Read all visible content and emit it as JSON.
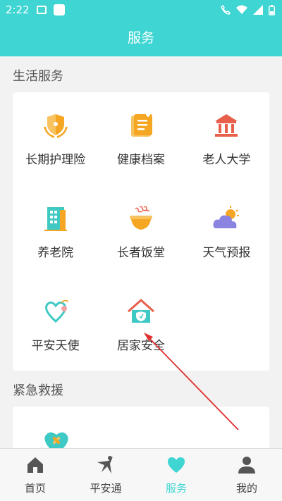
{
  "status_bar": {
    "time": "2:22"
  },
  "header": {
    "title": "服务"
  },
  "life_services": {
    "section_title": "生活服务",
    "items": [
      {
        "label": "长期护理险",
        "icon": "insurance-shield-icon"
      },
      {
        "label": "健康档案",
        "icon": "health-record-icon"
      },
      {
        "label": "老人大学",
        "icon": "university-building-icon"
      },
      {
        "label": "养老院",
        "icon": "nursing-home-building-icon"
      },
      {
        "label": "长者饭堂",
        "icon": "rice-bowl-icon"
      },
      {
        "label": "天气预报",
        "icon": "weather-cloud-sun-icon"
      },
      {
        "label": "平安天使",
        "icon": "angel-heart-icon"
      },
      {
        "label": "居家安全",
        "icon": "home-shield-icon"
      }
    ]
  },
  "emergency": {
    "section_title": "紧急救援",
    "items": [
      {
        "icon": "medical-heart-icon"
      }
    ]
  },
  "tabbar": {
    "tabs": [
      {
        "label": "首页",
        "icon": "home-icon"
      },
      {
        "label": "平安通",
        "icon": "figure-icon"
      },
      {
        "label": "服务",
        "icon": "heart-icon",
        "active": true
      },
      {
        "label": "我的",
        "icon": "person-icon"
      }
    ]
  },
  "colors": {
    "primary": "#3fd5d3",
    "icon_orange": "#f5a623",
    "icon_teal": "#3fc9c5",
    "icon_red": "#e8604c",
    "annotation_arrow": "#e03030"
  }
}
